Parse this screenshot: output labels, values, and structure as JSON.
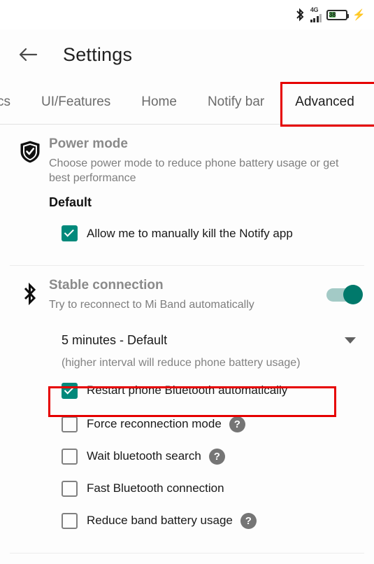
{
  "statusbar": {
    "bluetooth_icon": "bluetooth-icon",
    "network_label": "4G",
    "battery_percent": "38",
    "charging_icon": "charging-bolt-icon"
  },
  "appbar": {
    "back_icon": "back-arrow-icon",
    "title": "Settings"
  },
  "tabs": [
    {
      "label": "cs",
      "active": false
    },
    {
      "label": "UI/Features",
      "active": false
    },
    {
      "label": "Home",
      "active": false
    },
    {
      "label": "Notify bar",
      "active": false
    },
    {
      "label": "Advanced",
      "active": true
    }
  ],
  "power_mode": {
    "icon": "shield-check-icon",
    "title": "Power mode",
    "description": "Choose power mode to reduce phone battery usage or get best performance",
    "value": "Default",
    "checkbox": {
      "label": "Allow me to manually kill the Notify app",
      "checked": true
    }
  },
  "stable_connection": {
    "icon": "bluetooth-icon",
    "title": "Stable connection",
    "description": "Try to reconnect to Mi Band automatically",
    "toggle_on": true,
    "interval": {
      "value": "5 minutes - Default",
      "caret_icon": "chevron-down-icon",
      "hint": "(higher interval will reduce phone battery usage)"
    },
    "options": [
      {
        "label": "Restart phone Bluetooth automatically",
        "checked": true,
        "help": false
      },
      {
        "label": "Force reconnection mode",
        "checked": false,
        "help": true
      },
      {
        "label": "Wait bluetooth search",
        "checked": false,
        "help": true
      },
      {
        "label": "Fast Bluetooth connection",
        "checked": false,
        "help": false
      },
      {
        "label": "Reduce band battery usage",
        "checked": false,
        "help": true
      }
    ],
    "help_icon_glyph": "?"
  },
  "annotations": {
    "advanced_tab_highlight": "red-box-advanced-tab",
    "restart_bluetooth_highlight": "red-box-restart-bluetooth"
  },
  "colors": {
    "accent_teal": "#00897b",
    "toggle_thumb": "#00796b",
    "toggle_track": "#a3cac6",
    "annotation_red": "#e60000",
    "battery_green": "#4caf50"
  }
}
